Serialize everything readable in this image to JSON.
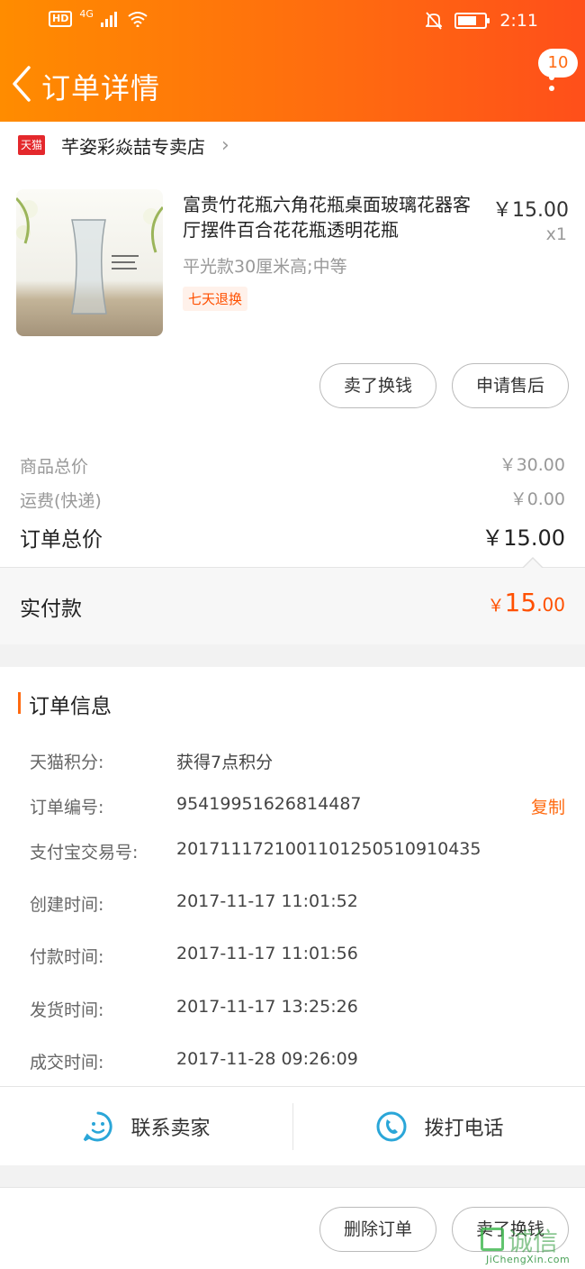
{
  "status_bar": {
    "network": "4G",
    "hd": "HD",
    "time": "2:11"
  },
  "nav": {
    "title": "订单详情",
    "badge_count": "10"
  },
  "shop": {
    "logo_text": "天猫",
    "name": "芊姿彩焱喆专卖店"
  },
  "product": {
    "title": "富贵竹花瓶六角花瓶桌面玻璃花器客厅摆件百合花花瓶透明花瓶",
    "price": "￥15.00",
    "quantity": "x1",
    "sku": "平光款30厘米高;中等",
    "tag": "七天退换"
  },
  "item_actions": {
    "sell": "卖了换钱",
    "after_sale": "申请售后"
  },
  "fees": {
    "goods_total_label": "商品总价",
    "goods_total_value": "￥30.00",
    "shipping_label": "运费(快递)",
    "shipping_value": "￥0.00",
    "order_total_label": "订单总价",
    "order_total_value": "￥15.00"
  },
  "paid": {
    "label": "实付款",
    "symbol": "￥",
    "integer": "15",
    "decimal": ".00"
  },
  "order_info": {
    "title": "订单信息",
    "copy_label": "复制",
    "rows": [
      {
        "label": "天猫积分:",
        "value": "获得7点积分"
      },
      {
        "label": "订单编号:",
        "value": "95419951626814487"
      },
      {
        "label": "支付宝交易号:",
        "value": "2017111721001101250510910435"
      },
      {
        "label": "创建时间:",
        "value": "2017-11-17 11:01:52"
      },
      {
        "label": "付款时间:",
        "value": "2017-11-17 11:01:56"
      },
      {
        "label": "发货时间:",
        "value": "2017-11-17 13:25:26"
      },
      {
        "label": "成交时间:",
        "value": "2017-11-28 09:26:09"
      }
    ]
  },
  "contact": {
    "seller": "联系卖家",
    "call": "拨打电话"
  },
  "footer_actions": {
    "delete": "删除订单",
    "sell": "卖了换钱"
  },
  "watermark": {
    "text": "诚信",
    "url": "JiChengXin.com"
  },
  "colors": {
    "accent": "#ff6a10",
    "price_red": "#ff5000",
    "tmall_red": "#e4282c"
  }
}
